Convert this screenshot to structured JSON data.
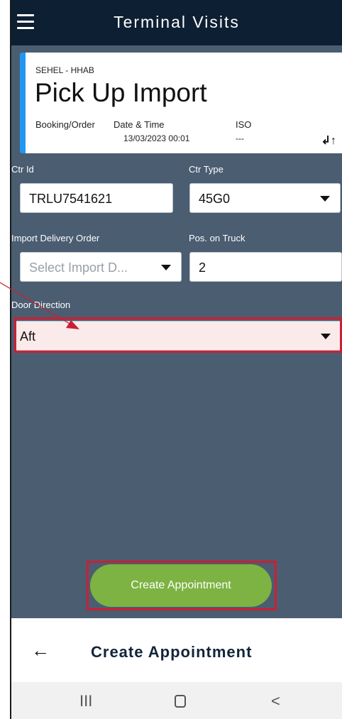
{
  "app": {
    "title": "Terminal Visits"
  },
  "visit": {
    "terminal": "SEHEL - HHAB",
    "type": "Pick Up Import",
    "booking_label": "Booking/Order",
    "datetime_label": "Date & Time",
    "datetime_value": "13/03/2023 00:01",
    "iso_label": "ISO",
    "iso_value": "---"
  },
  "form": {
    "ctr_id": {
      "label": "Ctr Id",
      "value": "TRLU7541621"
    },
    "ctr_type": {
      "label": "Ctr Type",
      "value": "45G0"
    },
    "import_delivery_order": {
      "label": "Import Delivery Order",
      "placeholder": "Select Import D..."
    },
    "pos_on_truck": {
      "label": "Pos. on Truck",
      "value": "2"
    },
    "door_direction": {
      "label": "Door Direction",
      "value": "Aft"
    }
  },
  "actions": {
    "create_button": "Create Appointment"
  },
  "footer": {
    "back_icon": "←",
    "title": "Create Appointment"
  },
  "navbar": {
    "recents": "III",
    "back": "<"
  },
  "icons": {
    "menu": "menu-icon",
    "swap": "swap-icon",
    "dropdown": "chevron-down-icon"
  },
  "colors": {
    "topbar": "#0d1f33",
    "content_bg": "#4a5d71",
    "accent": "#2296f3",
    "button": "#7cb342",
    "highlight": "#cc1f34"
  }
}
